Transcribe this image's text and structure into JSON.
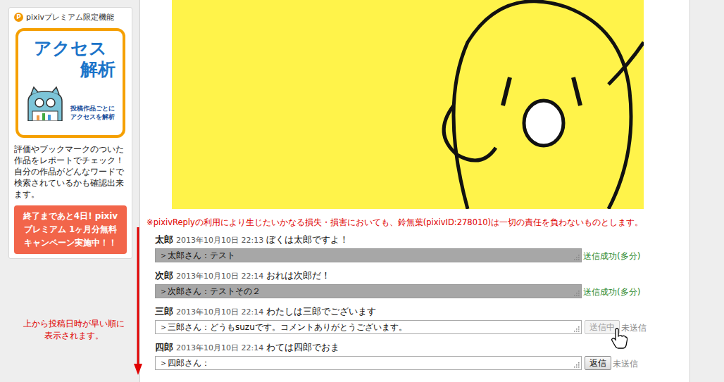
{
  "sidebar": {
    "badge": "P",
    "header": "pixivプレミアム限定機能",
    "banner": {
      "title_top": "アクセス",
      "title_bottom": "解析",
      "caption": "投稿作品ごとにアクセスを解析"
    },
    "description": "評価やブックマークのついた作品をレポートでチェック！自分の作品がどんなワードで検索されているかも確認出来ます。",
    "campaign": "終了まであと4日! pixivプレミアム 1ヶ月分無料キャンペーン実施中！！"
  },
  "annotation": "上から投稿日時が早い順に表示されます。",
  "disclaimer": "※pixivReplyの利用により生じたいかなる損失・損害においても、鈴無葉(pixivID:278010)は一切の責任を負わないものとします。",
  "comments": [
    {
      "author": "太郎",
      "date": "2013年10月10日 22:13",
      "message": "ぼくは太郎ですよ！",
      "reply": "＞太郎さん：テスト",
      "kind": "sent",
      "button": "",
      "disabled": true,
      "status": "送信成功(多分)"
    },
    {
      "author": "次郎",
      "date": "2013年10月10日 22:14",
      "message": "おれは次郎だ！",
      "reply": "＞次郎さん：テストその２",
      "kind": "sent",
      "button": "",
      "disabled": true,
      "status": "送信成功(多分)"
    },
    {
      "author": "三郎",
      "date": "2013年10月10日 22:14",
      "message": "わたしは三郎でございます",
      "reply": "＞三郎さん：どうもsuzuです。コメントありがとうございます。",
      "kind": "pending",
      "button": "送信中",
      "disabled": true,
      "status": "未送信"
    },
    {
      "author": "四郎",
      "date": "2013年10月10日 22:14",
      "message": "わては四郎でおま",
      "reply": "＞四郎さん：",
      "kind": "pending",
      "button": "返信",
      "disabled": false,
      "status": "未送信"
    }
  ]
}
